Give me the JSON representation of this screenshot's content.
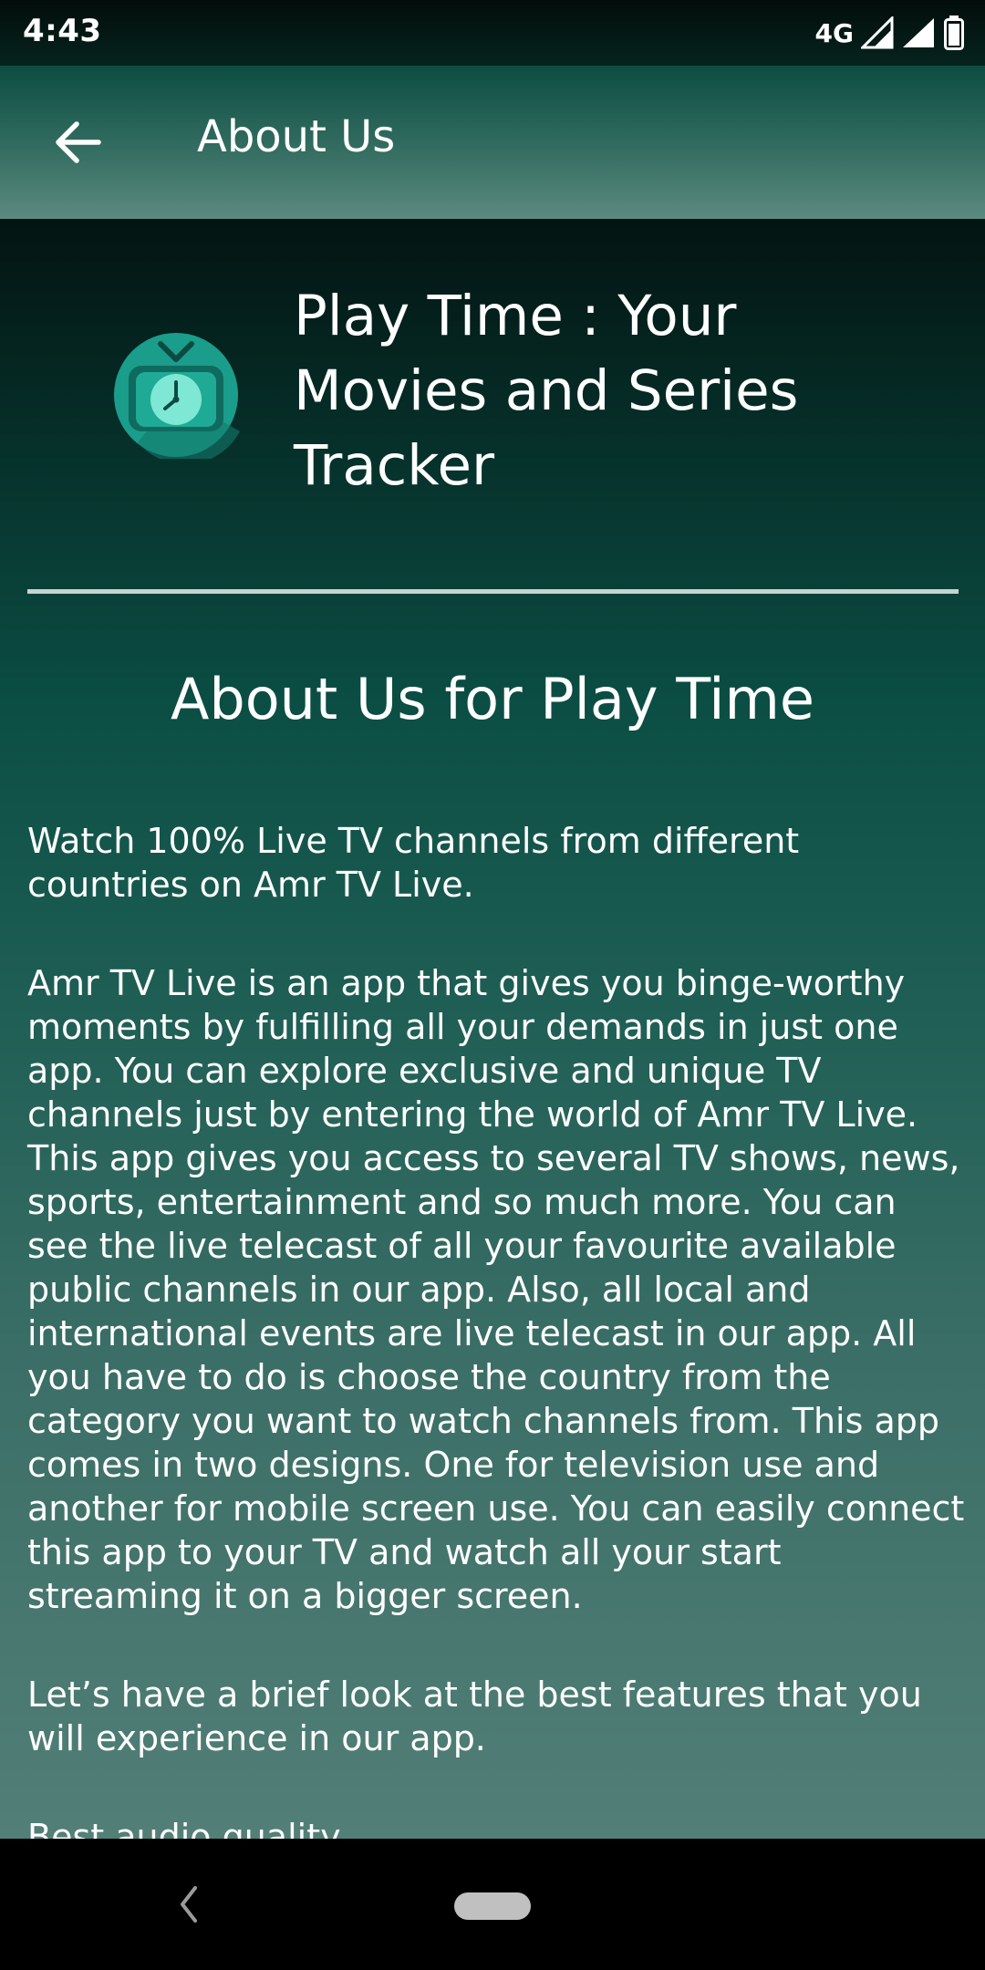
{
  "status_bar": {
    "time": "4:43",
    "network": "4G",
    "icons": [
      "signal-4g-icon",
      "signal-icon",
      "battery-icon"
    ]
  },
  "app_bar": {
    "back_icon": "arrow-left-icon",
    "title": "About Us"
  },
  "header": {
    "logo_icon": "tv-clock-icon",
    "app_name": "Play Time : Your Movies and Series Tracker"
  },
  "section": {
    "title": "About Us for Play Time"
  },
  "paragraphs": [
    "Watch 100% Live TV channels from different countries on Amr TV Live.",
    "Amr TV Live is an app that gives you binge-worthy moments by fulfilling all your demands in just one app. You can explore exclusive and unique TV channels just by entering the world of Amr TV Live. This app gives you access to several TV shows, news, sports, entertainment and so much more. You can see the live telecast of all your favourite available public channels in our app. Also, all local and international events are live telecast in our app. All you have to do is choose the country from the category you want to watch channels from. This app comes in two designs. One for television use and another for mobile screen use. You can easily connect this app to your TV and watch all your start streaming it on a bigger screen.",
    "Let’s have a brief look at the best features that you will experience in our app.",
    "Best audio quality"
  ],
  "colors": {
    "accent_teal": "#1fa894",
    "divider": "#c7d3cf"
  },
  "nav_bar": {
    "back_icon": "nav-back-icon",
    "home_icon": "nav-home-pill"
  }
}
